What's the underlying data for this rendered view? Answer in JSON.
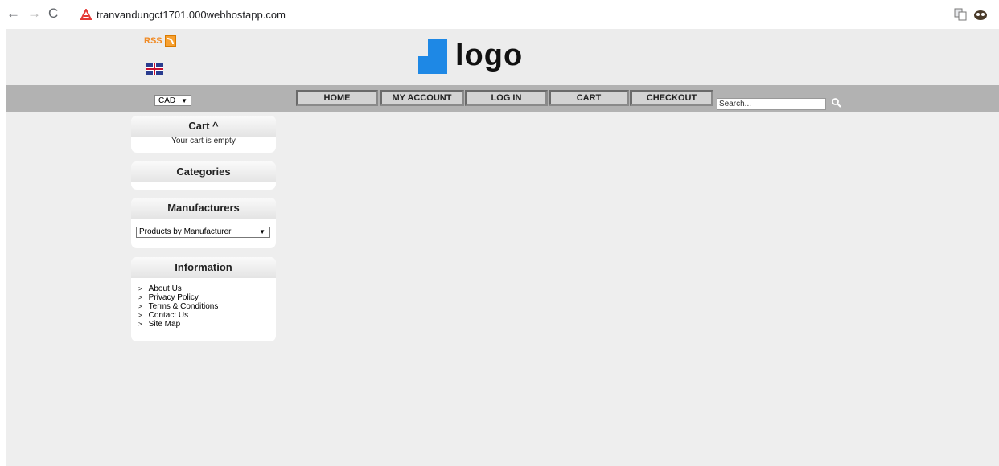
{
  "browser": {
    "url": "tranvandungct1701.000webhostapp.com"
  },
  "header": {
    "rss_label": "RSS",
    "logo_text": "logo"
  },
  "navbar": {
    "currency": "CAD",
    "menu": [
      {
        "label": "HOME"
      },
      {
        "label": "MY ACCOUNT"
      },
      {
        "label": "LOG IN"
      },
      {
        "label": "CART"
      },
      {
        "label": "CHECKOUT"
      }
    ],
    "search_value": "Search..."
  },
  "sidebar": {
    "cart": {
      "title": "Cart ^",
      "message": "Your cart is empty"
    },
    "categories": {
      "title": "Categories"
    },
    "manufacturers": {
      "title": "Manufacturers",
      "selected": "Products by Manufacturer"
    },
    "information": {
      "title": "Information",
      "links": [
        "About Us",
        "Privacy Policy",
        "Terms & Conditions",
        "Contact Us",
        "Site Map"
      ]
    }
  }
}
